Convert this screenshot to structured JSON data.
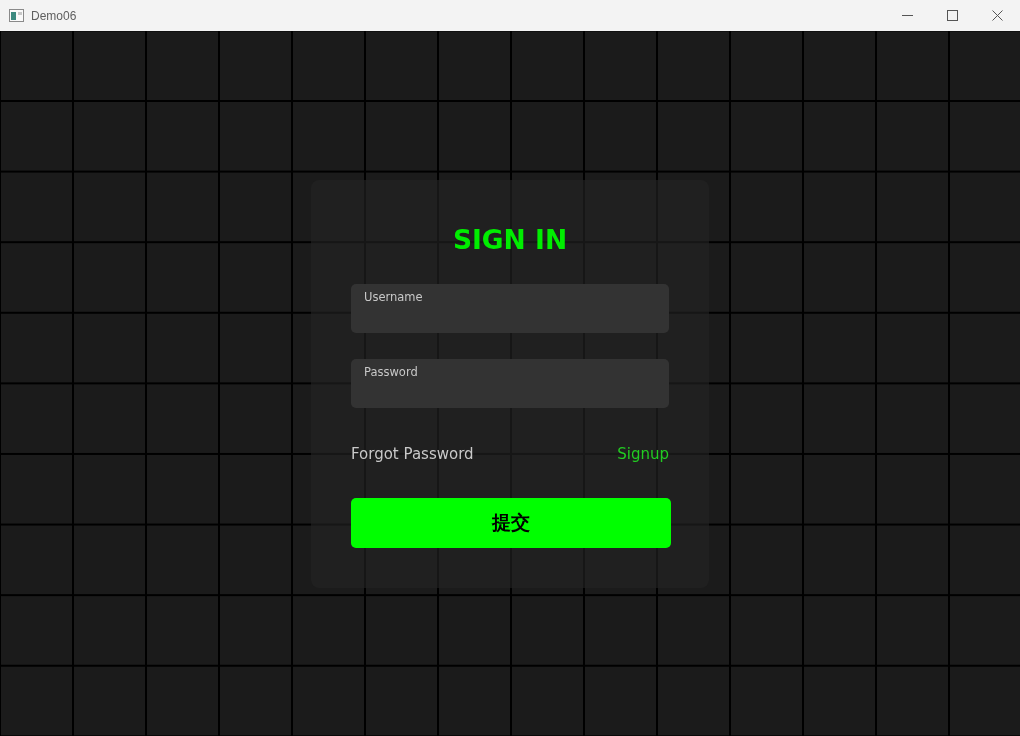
{
  "window": {
    "title": "Demo06"
  },
  "form": {
    "title": "SIGN IN",
    "fields": [
      {
        "placeholder": "Username"
      },
      {
        "placeholder": "Password"
      }
    ],
    "links": [
      {
        "label": "Forgot Password",
        "kind": "plain"
      },
      {
        "label": "Signup",
        "kind": "accent"
      }
    ],
    "submit": "提交"
  }
}
